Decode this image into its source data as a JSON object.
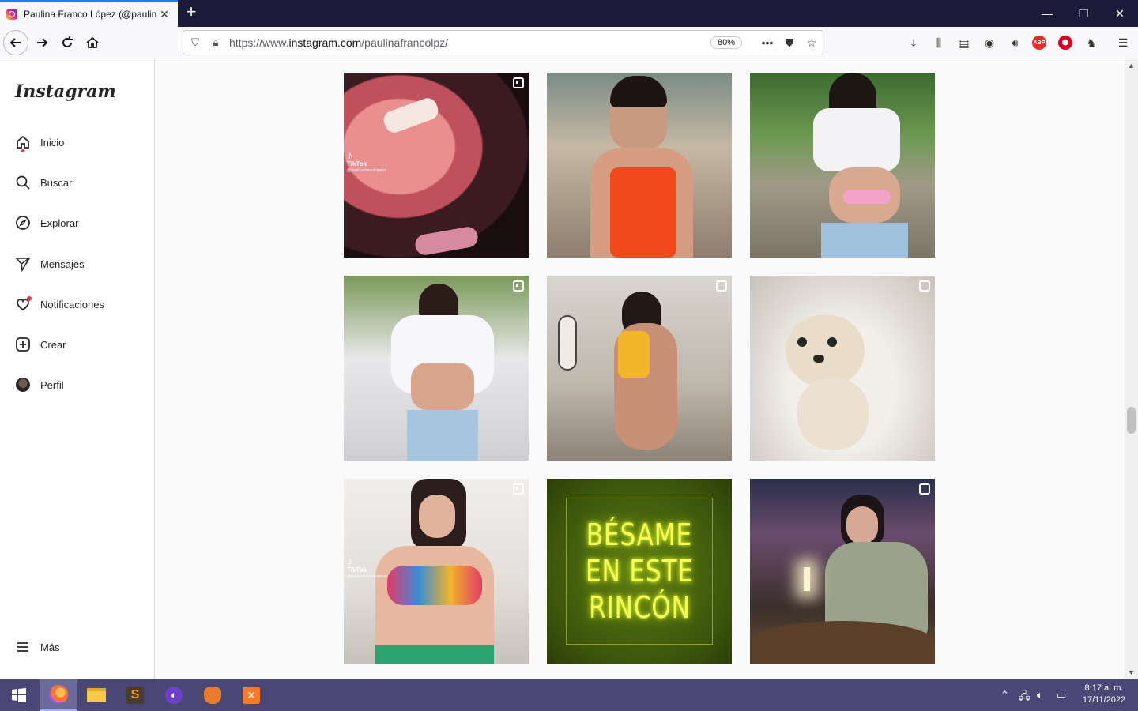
{
  "browser": {
    "tab_title": "Paulina Franco López (@paulinafrancolpz)",
    "tab_close": "✕",
    "new_tab": "+",
    "url_prefix": "https://www.",
    "url_domain": "instagram.com",
    "url_path": "/paulinafrancolpz/",
    "zoom": "80%",
    "page_actions": "•••"
  },
  "sidebar": {
    "logo": "Instagram",
    "items": [
      {
        "label": "Inicio",
        "icon": "home-icon"
      },
      {
        "label": "Buscar",
        "icon": "search-icon"
      },
      {
        "label": "Explorar",
        "icon": "compass-icon"
      },
      {
        "label": "Mensajes",
        "icon": "paper-plane-icon"
      },
      {
        "label": "Notificaciones",
        "icon": "heart-icon"
      },
      {
        "label": "Crear",
        "icon": "plus-square-icon"
      },
      {
        "label": "Perfil",
        "icon": "avatar"
      }
    ],
    "more_label": "Más"
  },
  "grid": {
    "posts": [
      {
        "type": "reel",
        "overlay": "TikTok",
        "handle": "@paulinafrancolopezz"
      },
      {
        "type": "photo"
      },
      {
        "type": "photo"
      },
      {
        "type": "reel"
      },
      {
        "type": "carousel"
      },
      {
        "type": "carousel"
      },
      {
        "type": "reel",
        "overlay": "TikTok",
        "handle": "@paulinafrancolopezz"
      },
      {
        "type": "photo",
        "neon_lines": [
          "BÉSAME",
          "EN ESTE",
          "RINCÓN"
        ]
      },
      {
        "type": "carousel"
      }
    ]
  },
  "taskbar": {
    "time": "8:17 a. m.",
    "date": "17/11/2022"
  },
  "colors": {
    "instagram_text": "#262626",
    "notification_dot": "#ff3040",
    "taskbar": "#4a4777",
    "titlebar": "#1c1b39"
  }
}
